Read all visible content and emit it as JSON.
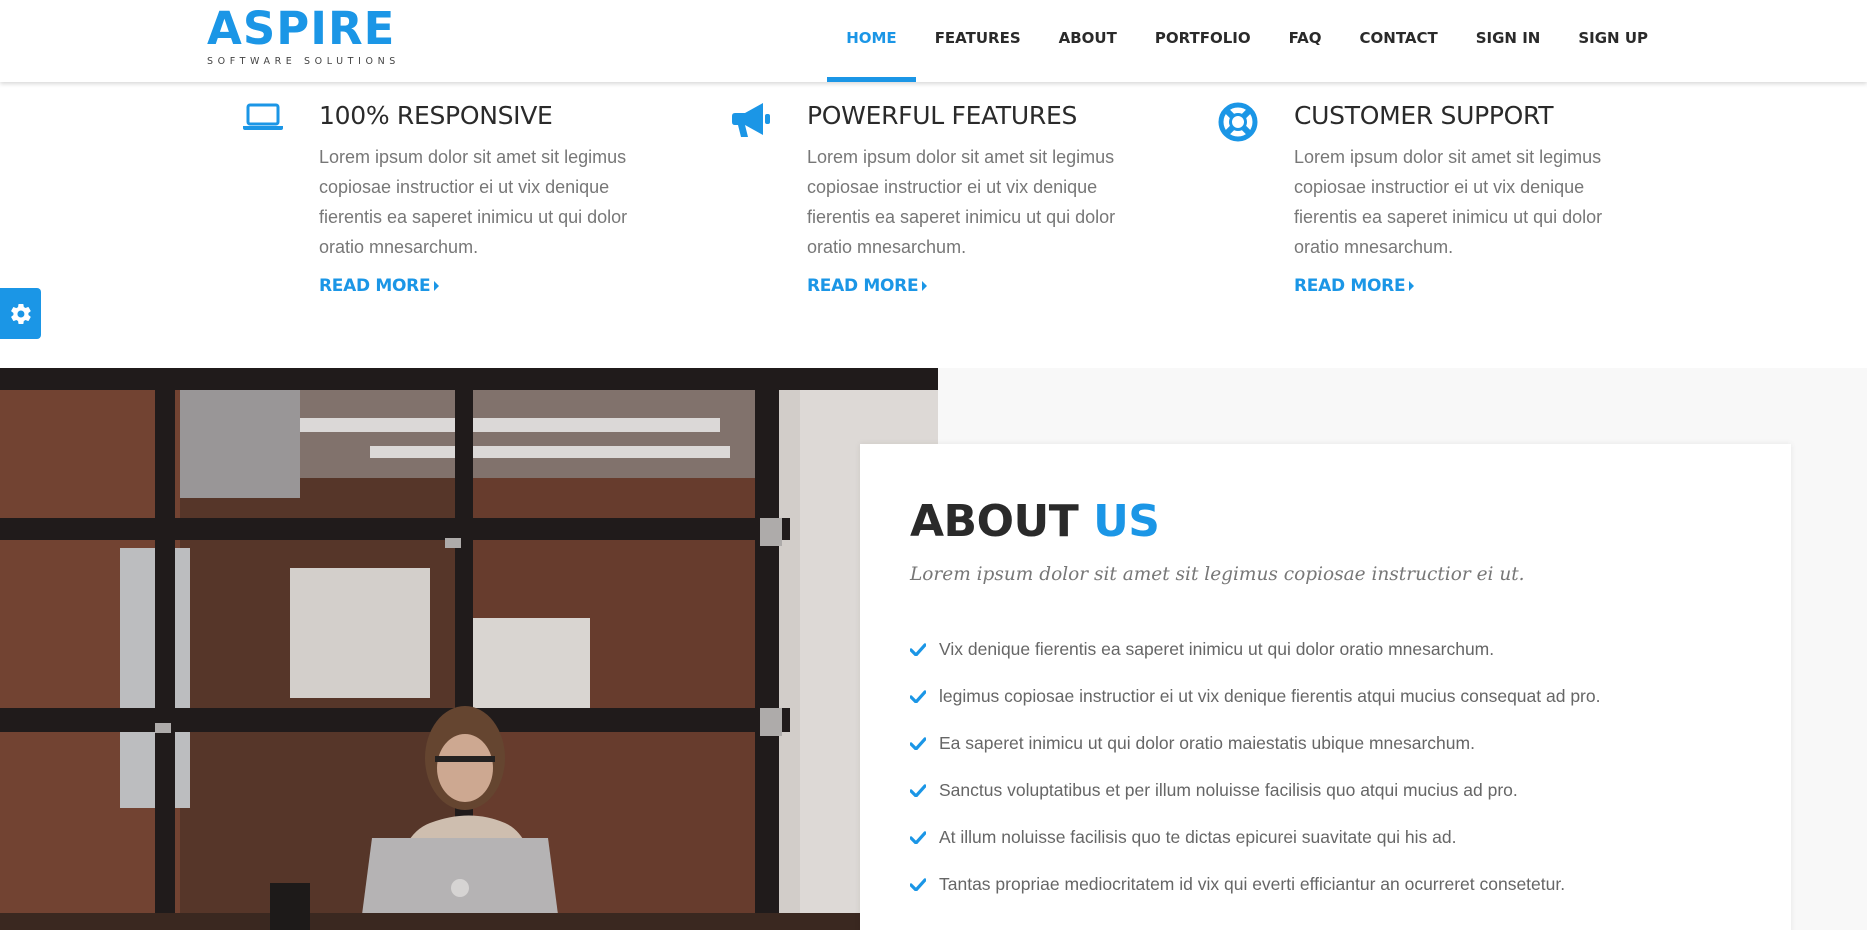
{
  "brand": {
    "name": "ASPIRE",
    "tagline": "SOFTWARE SOLUTIONS",
    "accent_color": "#1b96e6"
  },
  "nav": {
    "active": "HOME",
    "items": [
      {
        "label": "HOME"
      },
      {
        "label": "FEATURES"
      },
      {
        "label": "ABOUT"
      },
      {
        "label": "PORTFOLIO"
      },
      {
        "label": "FAQ"
      },
      {
        "label": "CONTACT"
      },
      {
        "label": "SIGN IN"
      },
      {
        "label": "SIGN UP"
      }
    ]
  },
  "settings": {
    "icon": "gear-icon"
  },
  "features": [
    {
      "icon": "laptop-icon",
      "title": "100% RESPONSIVE",
      "lines": [
        "Lorem ipsum dolor sit amet sit legimus",
        "copiosae instructior ei ut vix denique",
        "fierentis ea saperet inimicu ut qui dolor",
        "oratio mnesarchum."
      ],
      "link": "READ MORE"
    },
    {
      "icon": "megaphone-icon",
      "title": "POWERFUL FEATURES",
      "lines": [
        "Lorem ipsum dolor sit amet sit legimus",
        "copiosae instructior ei ut vix denique",
        "fierentis ea saperet inimicu ut qui dolor",
        "oratio mnesarchum."
      ],
      "link": "READ MORE"
    },
    {
      "icon": "life-ring-icon",
      "title": "CUSTOMER SUPPORT",
      "lines": [
        "Lorem ipsum dolor sit amet sit legimus",
        "copiosae instructior ei ut vix denique",
        "fierentis ea saperet inimicu ut qui dolor",
        "oratio mnesarchum."
      ],
      "link": "READ MORE"
    }
  ],
  "about": {
    "title_main": "ABOUT",
    "title_accent": "US",
    "subtitle": "Lorem ipsum dolor sit amet sit legimus copiosae instructior ei ut.",
    "list_icon": "check-icon",
    "items": [
      "Vix denique fierentis ea saperet inimicu ut qui dolor oratio mnesarchum.",
      "legimus copiosae instructior ei ut vix denique fierentis atqui mucius consequat ad pro.",
      "Ea saperet inimicu ut qui dolor oratio maiestatis ubique mnesarchum.",
      "Sanctus voluptatibus et per illum noluisse facilisis quo atqui mucius ad pro.",
      "At illum noluisse facilisis quo te dictas epicurei suavitate qui his ad.",
      "Tantas propriae mediocritatem id vix qui everti efficiantur an ocurreret consetetur."
    ]
  }
}
